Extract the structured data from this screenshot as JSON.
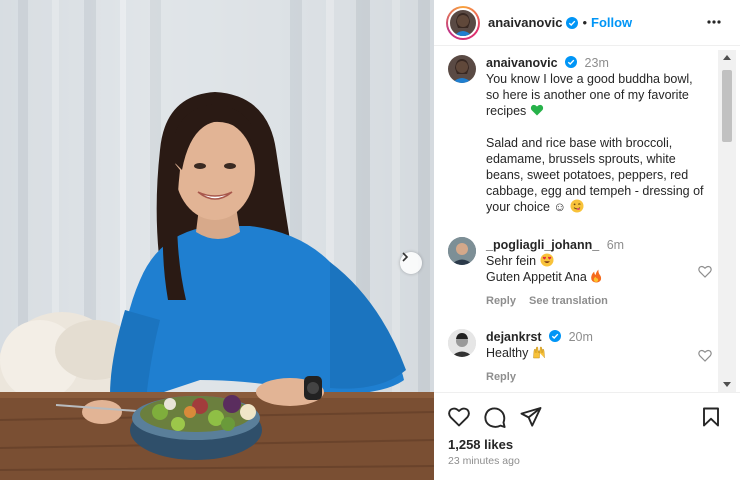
{
  "header": {
    "username": "anaivanovic",
    "follow_label": "Follow",
    "dot": "•"
  },
  "caption": {
    "username": "anaivanovic",
    "time": "23m",
    "line1": "You know I love a good buddha bowl, so here is another one of my favorite recipes",
    "line2": "Salad and rice base with broccoli, edamame, brussels sprouts, white beans, sweet potatoes, peppers, red cabbage, egg and tempeh - dressing of your choice",
    "smile": "☺"
  },
  "comments": [
    {
      "username": "_pogliagli_johann_",
      "time": "6m",
      "line1": "Sehr fein",
      "line2": "Guten Appetit Ana",
      "reply_label": "Reply",
      "translate_label": "See translation"
    },
    {
      "username": "dejankrst",
      "time": "20m",
      "line1": "Healthy",
      "reply_label": "Reply"
    }
  ],
  "footer": {
    "likes": "1,258 likes",
    "ago": "23 minutes ago"
  },
  "icons": {
    "verified": "verified-badge-icon",
    "more": "more-options-icon",
    "like": "heart-icon",
    "comment": "comment-icon",
    "share": "paper-plane-icon",
    "save": "bookmark-icon",
    "next": "chevron-right-icon"
  },
  "colors": {
    "accent": "#0095f6",
    "shirt": "#1f7fd0",
    "muted": "#8e8e8e"
  }
}
